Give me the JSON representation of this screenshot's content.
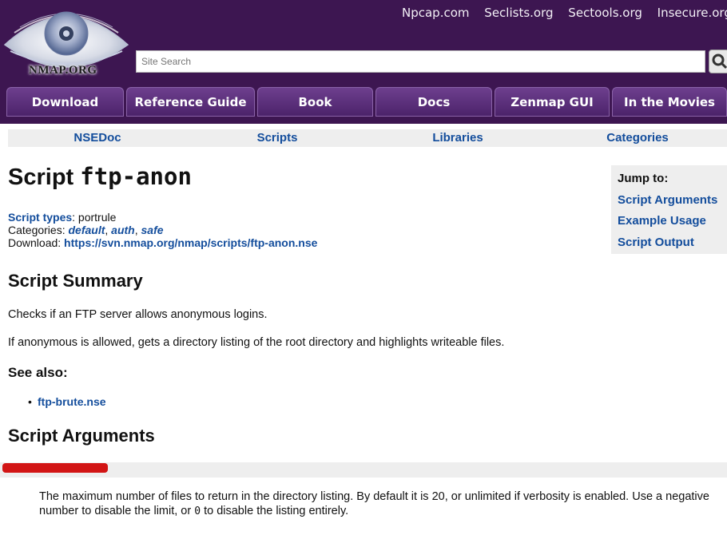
{
  "header": {
    "logo_text": "NMAP.ORG",
    "top_links": [
      "Npcap.com",
      "Seclists.org",
      "Sectools.org",
      "Insecure.org"
    ],
    "search_placeholder": "Site Search",
    "nav_tabs": [
      "Download",
      "Reference Guide",
      "Book",
      "Docs",
      "Zenmap GUI",
      "In the Movies"
    ],
    "colors": {
      "header_bg": "#3d1651",
      "tab_bg": "#5a2d7a",
      "link": "#134d9c"
    }
  },
  "subnav": [
    "NSEDoc",
    "Scripts",
    "Libraries",
    "Categories"
  ],
  "page": {
    "title_prefix": "Script",
    "title_name": "ftp-anon",
    "script_types_label": "Script types",
    "script_types_value": ": portrule",
    "categories_label": "Categories: ",
    "categories": [
      "default",
      "auth",
      "safe"
    ],
    "download_label": "Download: ",
    "download_url": "https://svn.nmap.org/nmap/scripts/ftp-anon.nse",
    "summary_heading": "Script Summary",
    "summary_p1": "Checks if an FTP server allows anonymous logins.",
    "summary_p2": "If anonymous is allowed, gets a directory listing of the root directory and highlights writeable files.",
    "see_also_heading": "See also:",
    "see_also_items": [
      "ftp-brute.nse"
    ],
    "arguments_heading": "Script Arguments",
    "argument_desc_a": "The maximum number of files to return in the directory listing. By default it is 20, or unlimited if verbosity is enabled. Use a negative number to disable the limit, or ",
    "argument_desc_code": "0",
    "argument_desc_b": " to disable the listing entirely."
  },
  "jumpto": {
    "title": "Jump to:",
    "links": [
      "Script Arguments",
      "Example Usage",
      "Script Output"
    ]
  }
}
